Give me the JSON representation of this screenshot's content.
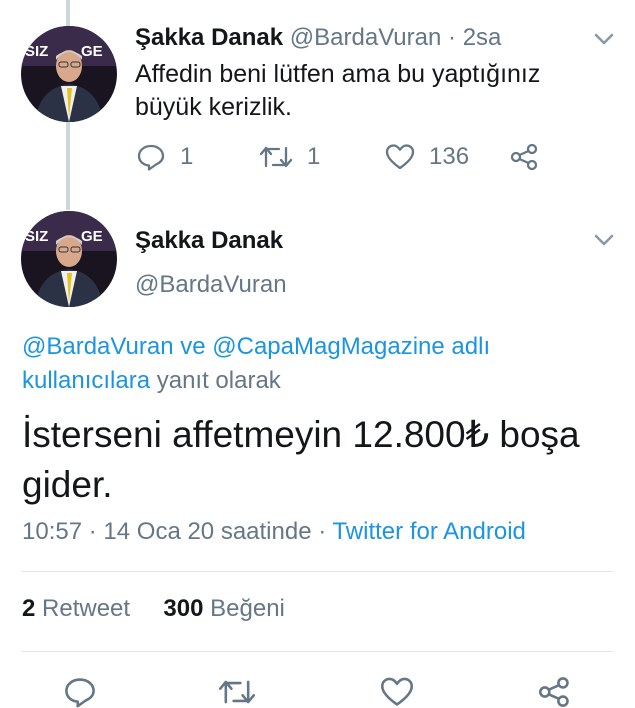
{
  "first_tweet": {
    "display_name": "Şakka Danak",
    "handle": "@BardaVuran",
    "separator": "·",
    "time": "2sa",
    "text": "Affedin beni lütfen ama bu yaptığınız büyük kerizlik.",
    "replies": "1",
    "retweets": "1",
    "likes": "136"
  },
  "main_tweet": {
    "display_name": "Şakka Danak",
    "handle": "@BardaVuran",
    "reply_to": {
      "user1": "@BardaVuran",
      "connector": "ve",
      "user2": "@CapaMagMagazine adlı kullanıcılara",
      "suffix": "yanıt olarak"
    },
    "text": "İsterseni affetmeyin 12.800₺ boşa gider.",
    "time": "10:57",
    "dot1": "·",
    "date": "14 Oca 20 saatinde",
    "dot2": "·",
    "source": "Twitter for Android",
    "retweet_count": "2",
    "retweet_label": "Retweet",
    "like_count": "300",
    "like_label": "Beğeni"
  },
  "avatar_caption_left": "SIZ",
  "avatar_caption_right": "GE",
  "colors": {
    "link": "#1b95e0",
    "secondary_text": "#657786",
    "divider": "#e1e8ed",
    "thread_line": "#ccd6dd"
  },
  "icons": {
    "reply": "reply-icon",
    "retweet": "retweet-icon",
    "like": "heart-icon",
    "share": "share-icon",
    "caret": "chevron-down-icon"
  }
}
